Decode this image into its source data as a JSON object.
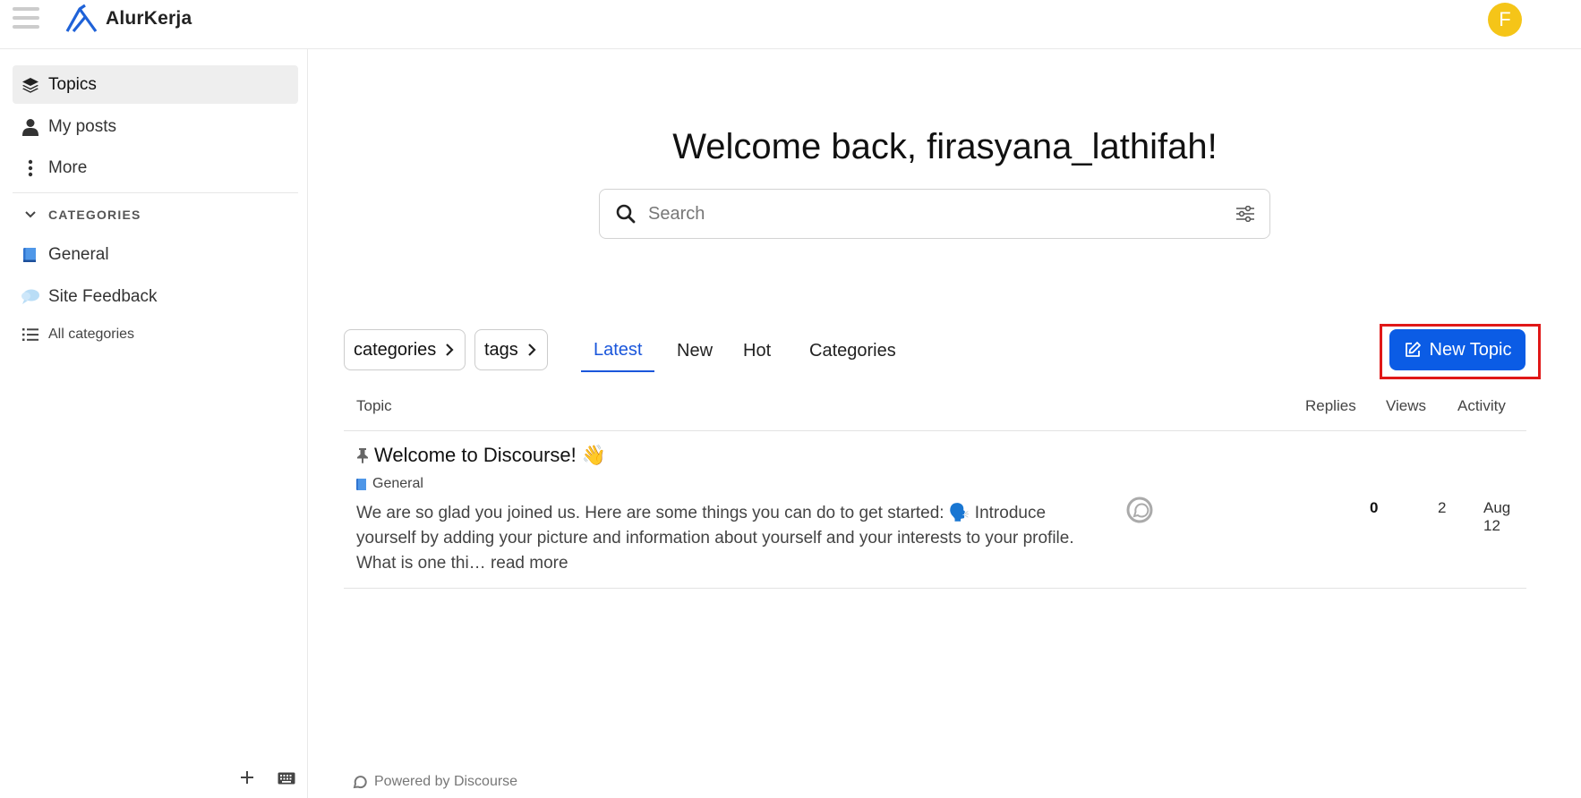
{
  "header": {
    "logo_text": "AlurKerja",
    "avatar_letter": "F",
    "colors": {
      "avatar": "#f5c518",
      "logo": "#1f62d8"
    }
  },
  "sidebar": {
    "items": [
      {
        "label": "Topics",
        "icon": "layers-icon",
        "active": true
      },
      {
        "label": "My posts",
        "icon": "user-icon"
      },
      {
        "label": "More",
        "icon": "vertical-ellipsis-icon"
      }
    ],
    "categories_header": "CATEGORIES",
    "categories": [
      {
        "label": "General",
        "icon": "book-icon"
      },
      {
        "label": "Site Feedback",
        "icon": "speech-balloon-icon"
      }
    ],
    "all_categories": "All categories"
  },
  "main": {
    "welcome": "Welcome back, firasyana_lathifah!",
    "search": {
      "placeholder": "Search",
      "value": ""
    },
    "filters": {
      "categories": "categories",
      "tags": "tags"
    },
    "tabs": [
      {
        "label": "Latest",
        "active": true
      },
      {
        "label": "New"
      },
      {
        "label": "Hot"
      },
      {
        "label": "Categories"
      }
    ],
    "new_topic": "New Topic",
    "table": {
      "headers": {
        "topic": "Topic",
        "replies": "Replies",
        "views": "Views",
        "activity": "Activity"
      },
      "rows": [
        {
          "title": "Welcome to Discourse! 👋",
          "category": "General",
          "excerpt": "We are so glad you joined us. Here are some things you can do to get started: 🗣️ Introduce yourself by adding your picture and information about yourself and your interests to your profile. What is one thi… ",
          "read_more": "read more",
          "replies": "0",
          "views": "2",
          "activity": "Aug 12"
        }
      ]
    },
    "powered_by": "Powered by Discourse",
    "colors": {
      "accent": "#0b5ce5",
      "highlight": "#e01818"
    }
  }
}
